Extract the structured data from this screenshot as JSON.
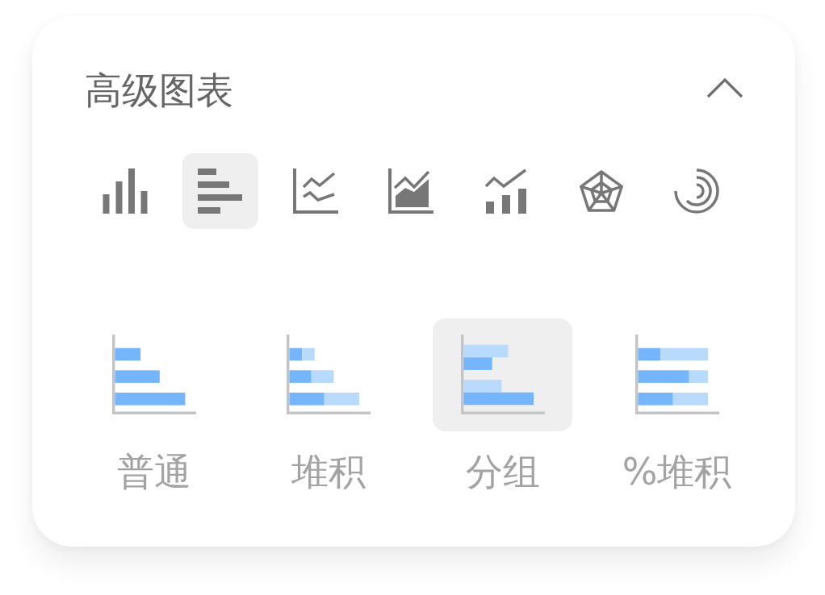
{
  "header": {
    "title": "高级图表",
    "expanded": true
  },
  "chart_types": [
    {
      "kind": "column",
      "selected": false
    },
    {
      "kind": "bar",
      "selected": true
    },
    {
      "kind": "line",
      "selected": false
    },
    {
      "kind": "area",
      "selected": false
    },
    {
      "kind": "combo",
      "selected": false
    },
    {
      "kind": "radar",
      "selected": false
    },
    {
      "kind": "radial",
      "selected": false
    }
  ],
  "bar_styles": [
    {
      "kind": "plain",
      "label": "普通",
      "selected": false
    },
    {
      "kind": "stacked",
      "label": "堆积",
      "selected": false
    },
    {
      "kind": "grouped",
      "label": "分组",
      "selected": true
    },
    {
      "kind": "percent_stacked",
      "label": "%堆积",
      "selected": false
    }
  ]
}
